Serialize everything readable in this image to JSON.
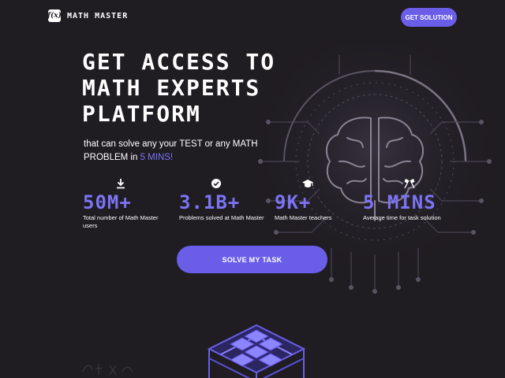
{
  "header": {
    "logo_mark": "f(x)",
    "logo_text": "MATH MASTER",
    "cta_label": "GET SOLUTION"
  },
  "hero": {
    "title": "GET ACCESS TO MATH EXPERTS PLATFORM",
    "subtitle_part1": "that can solve any your TEST or any MATH PROBLEM in ",
    "subtitle_accent": "5 MINS!"
  },
  "stats": [
    {
      "icon": "download-icon",
      "value": "50M+",
      "label": "Total number of Math Master users"
    },
    {
      "icon": "check-circle-icon",
      "value": "3.1B+",
      "label": "Problems solved at Math Master"
    },
    {
      "icon": "graduation-cap-icon",
      "value": "9K+",
      "label": "Math Master teachers"
    },
    {
      "icon": "racing-flags-icon",
      "value": "5 MINS",
      "label": "Average time for task solution"
    }
  ],
  "cta": {
    "label": "SOLVE MY TASK"
  },
  "colors": {
    "background": "#1f1c22",
    "accent": "#6a5ee8",
    "accent_text": "#7d74f5",
    "text": "#ffffff"
  }
}
